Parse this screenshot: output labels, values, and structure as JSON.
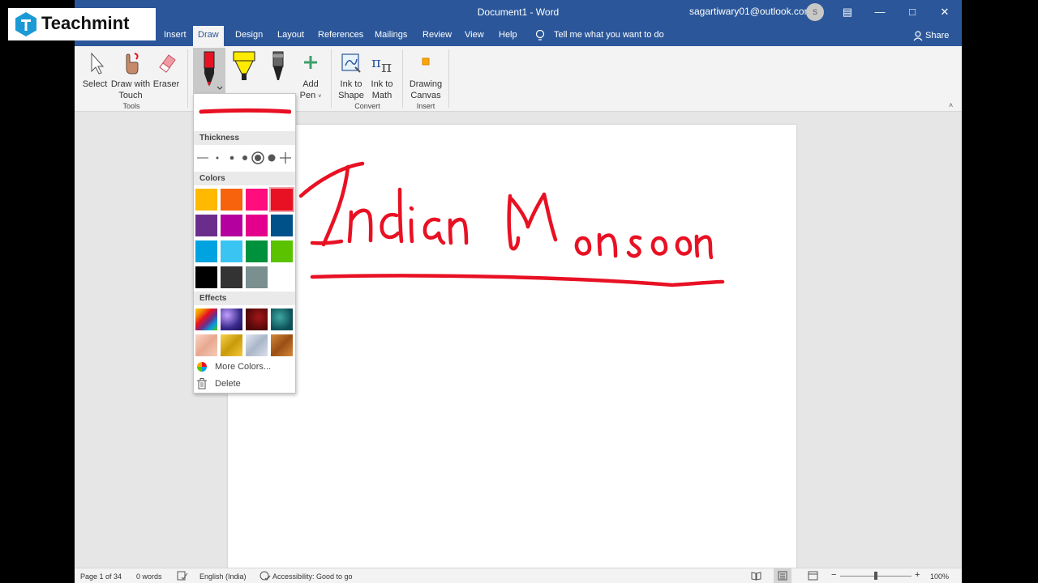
{
  "window": {
    "title": "Document1 - Word",
    "account": "sagartiwary01@outlook.com",
    "avatar": "S",
    "controls": [
      "Minimize",
      "Restore",
      "Close"
    ]
  },
  "logo": {
    "text": "Teachmint"
  },
  "tabs": {
    "insert": "Insert",
    "draw": "Draw",
    "design": "Design",
    "layout": "Layout",
    "references": "References",
    "mailings": "Mailings",
    "review": "Review",
    "view": "View",
    "help": "Help",
    "tell_me": "Tell me what you want to do",
    "share": "Share"
  },
  "ribbon": {
    "select": "Select",
    "draw_with_touch_1": "Draw with",
    "draw_with_touch_2": "Touch",
    "eraser": "Eraser",
    "tools_label": "Tools",
    "add_pen_1": "Add",
    "add_pen_2": "Pen",
    "ink_to_shape_1": "Ink to",
    "ink_to_shape_2": "Shape",
    "ink_to_math_1": "Ink to",
    "ink_to_math_2": "Math",
    "convert_label": "Convert",
    "drawing_canvas_1": "Drawing",
    "drawing_canvas_2": "Canvas",
    "insert_label": "Insert"
  },
  "pen_menu": {
    "thickness_header": "Thickness",
    "colors_header": "Colors",
    "effects_header": "Effects",
    "more_colors": "More Colors...",
    "delete": "Delete",
    "selected_color": "#e81123",
    "colors": [
      "#ffb900",
      "#f7630c",
      "#ff0c7e",
      "#e81123",
      "#6b2d8b",
      "#b4009e",
      "#e3008c",
      "#00508a",
      "#00a2e0",
      "#3ac4f2",
      "#00913c",
      "#5bc200",
      "#000000",
      "#333333",
      "#7a8f8f",
      "#ffffff"
    ],
    "effects": [
      "rainbow",
      "galaxy",
      "lava",
      "ocean",
      "rose-gold",
      "gold",
      "silver",
      "bronze"
    ]
  },
  "document": {
    "handwriting": "Indian Monsoon",
    "ink_color": "#e81123"
  },
  "status": {
    "page": "Page 1 of 34",
    "words": "0 words",
    "language": "English (India)",
    "accessibility": "Accessibility: Good to go",
    "zoom": "100%"
  }
}
